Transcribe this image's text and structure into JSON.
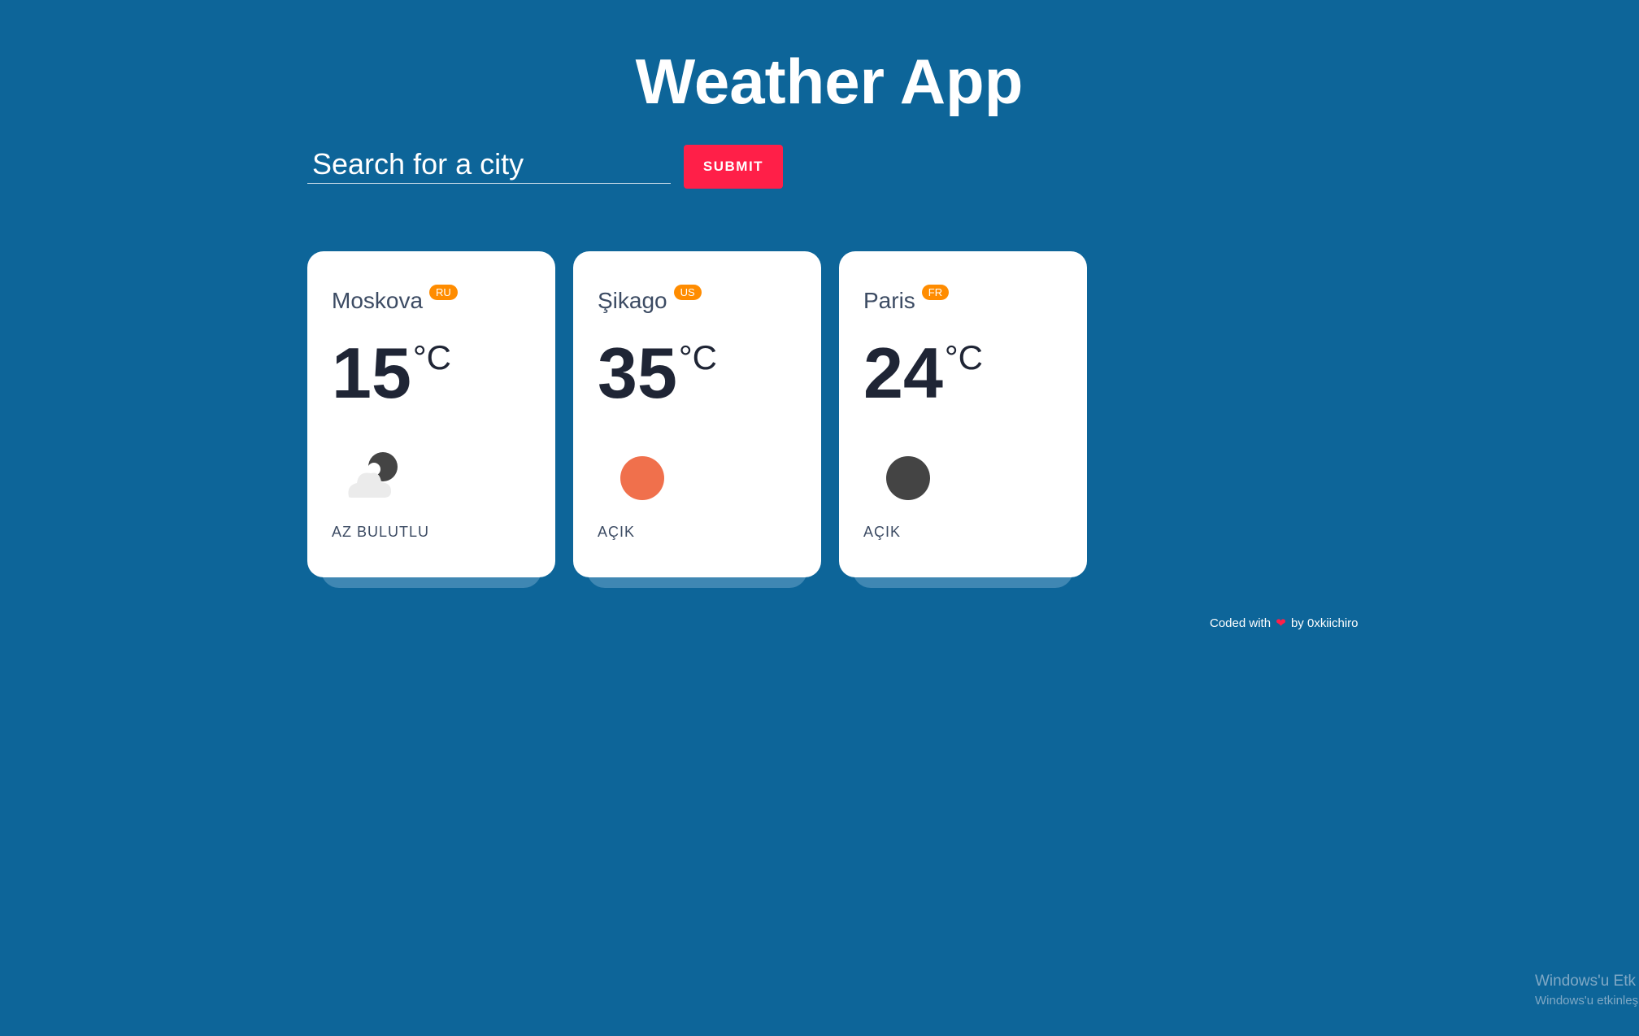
{
  "app": {
    "title": "Weather App"
  },
  "search": {
    "placeholder": "Search for a city",
    "value": "",
    "submit_label": "SUBMIT"
  },
  "cities": [
    {
      "name": "Moskova",
      "country": "RU",
      "temperature": "15",
      "unit": "°C",
      "description": "AZ BULUTLU",
      "icon": "partly-cloudy-night-icon"
    },
    {
      "name": "Şikago",
      "country": "US",
      "temperature": "35",
      "unit": "°C",
      "description": "AÇIK",
      "icon": "clear-day-sun-icon"
    },
    {
      "name": "Paris",
      "country": "FR",
      "temperature": "24",
      "unit": "°C",
      "description": "AÇIK",
      "icon": "clear-night-moon-icon"
    }
  ],
  "footer": {
    "prefix": "Coded with",
    "heart_icon": "heart-icon",
    "suffix": "by 0xkiichiro"
  },
  "os_watermark": {
    "line1": "Windows'u Etk",
    "line2": "Windows'u etkinleş"
  },
  "colors": {
    "background": "#0d6599",
    "accent": "#ff1f48",
    "badge": "#ff8c00",
    "sun": "#f0704c",
    "moon": "#444444",
    "card": "#ffffff"
  }
}
